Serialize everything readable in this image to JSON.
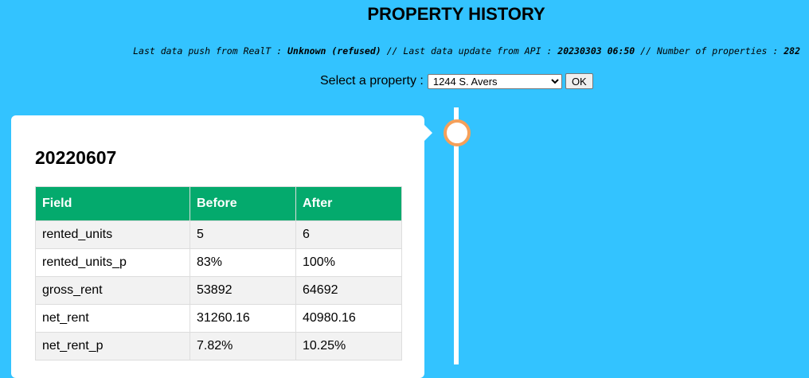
{
  "header": {
    "title": "PROPERTY HISTORY"
  },
  "info": {
    "push_label": "Last data push from RealT :",
    "push_value": "Unknown (refused)",
    "sep1": "//",
    "update_label": "Last data update from API :",
    "update_value": "20230303 06:50",
    "sep2": "//",
    "count_label": "Number of properties :",
    "count_value": "282"
  },
  "selector": {
    "label": "Select a property :",
    "selected": "1244 S. Avers",
    "ok_label": "OK"
  },
  "timeline": {
    "dot_color": "#f5a05a",
    "entries": [
      {
        "date": "20220607",
        "columns": [
          "Field",
          "Before",
          "After"
        ],
        "rows": [
          {
            "field": "rented_units",
            "before": "5",
            "after": "6"
          },
          {
            "field": "rented_units_p",
            "before": "83%",
            "after": "100%"
          },
          {
            "field": "gross_rent",
            "before": "53892",
            "after": "64692"
          },
          {
            "field": "net_rent",
            "before": "31260.16",
            "after": "40980.16"
          },
          {
            "field": "net_rent_p",
            "before": "7.82%",
            "after": "10.25%"
          }
        ]
      }
    ]
  },
  "colors": {
    "background": "#33c3ff",
    "table_header": "#04aa6d"
  }
}
